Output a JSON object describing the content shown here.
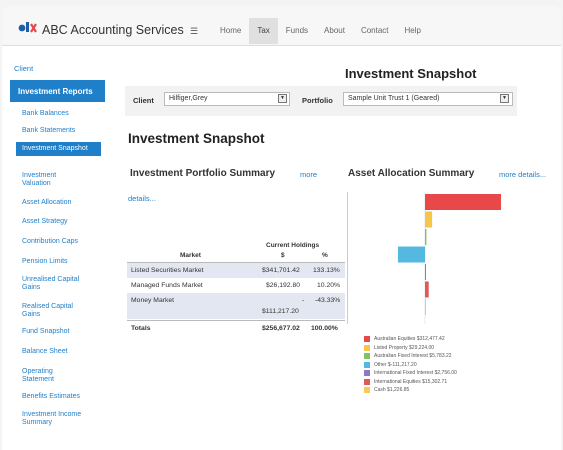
{
  "header": {
    "brand": "ABC Accounting Services",
    "menu_icon": "☰",
    "nav": [
      "Home",
      "Tax",
      "Funds",
      "About",
      "Contact",
      "Help"
    ],
    "active_nav": "Tax"
  },
  "sidebar": {
    "client_link": "Client",
    "section": "Investment Reports",
    "items": [
      "Bank Balances",
      "Bank Statements",
      "Investment Snapshot",
      "Investment Valuation",
      "Asset Allocation",
      "Asset Strategy",
      "Contribution Caps",
      "Pension Limits",
      "Unrealised Capital Gains",
      "Realised Capital Gains",
      "Fund Snapshot",
      "Balance Sheet",
      "Operating Statement",
      "Benefits Estimates",
      "Investment Income Summary"
    ],
    "active_item": "Investment Snapshot"
  },
  "page": {
    "title_top": "Investment Snapshot",
    "title_main": "Investment Snapshot"
  },
  "filters": {
    "client_label": "Client",
    "client_value": "Hilfiger,Grey",
    "portfolio_label": "Portfolio",
    "portfolio_value": "Sample Unit Trust 1 (Geared)"
  },
  "portfolio_summary": {
    "title": "Investment Portfolio Summary",
    "more_link": "more",
    "details_link": "details...",
    "col_market": "Market",
    "col_holdings": "Current Holdings",
    "col_dollar": "$",
    "col_pct": "%",
    "rows": [
      {
        "market": "Listed Securities Market",
        "amount": "$341,701.42",
        "pct": "133.13%"
      },
      {
        "market": "Managed Funds Market",
        "amount": "$26,192.80",
        "pct": "10.20%"
      },
      {
        "market": "Money Market",
        "amount": "-",
        "amount2": "$111,217.20",
        "pct": "-43.33%"
      }
    ],
    "totals": {
      "label": "Totals",
      "amount": "$256,677.02",
      "pct": "100.00%"
    }
  },
  "asset_allocation": {
    "title": "Asset Allocation Summary",
    "more_link": "more details..."
  },
  "chart_data": {
    "type": "bar",
    "orientation": "horizontal",
    "categories": [
      "Australian Equities",
      "Listed Property",
      "Australian Fixed Interest",
      "Other",
      "International Fixed Interest",
      "International Equities",
      "Cash"
    ],
    "values": [
      312477.42,
      29224.0,
      5783.22,
      -111217.2,
      2756.0,
      15302.71,
      1226.85
    ],
    "colors": [
      "#e8484a",
      "#f5c64a",
      "#7ec463",
      "#55b8e0",
      "#8b78c9",
      "#e05a5a",
      "#f7c85a"
    ],
    "legend": [
      "Australian Equities $312,477.42",
      "Listed Property $29,224.00",
      "Australian Fixed Interest $5,783.22",
      "Other $-111,217.20",
      "International Fixed Interest $2,756.00",
      "International Equities $15,302.71",
      "Cash $1,226.85"
    ],
    "legend_position": "bottom"
  }
}
